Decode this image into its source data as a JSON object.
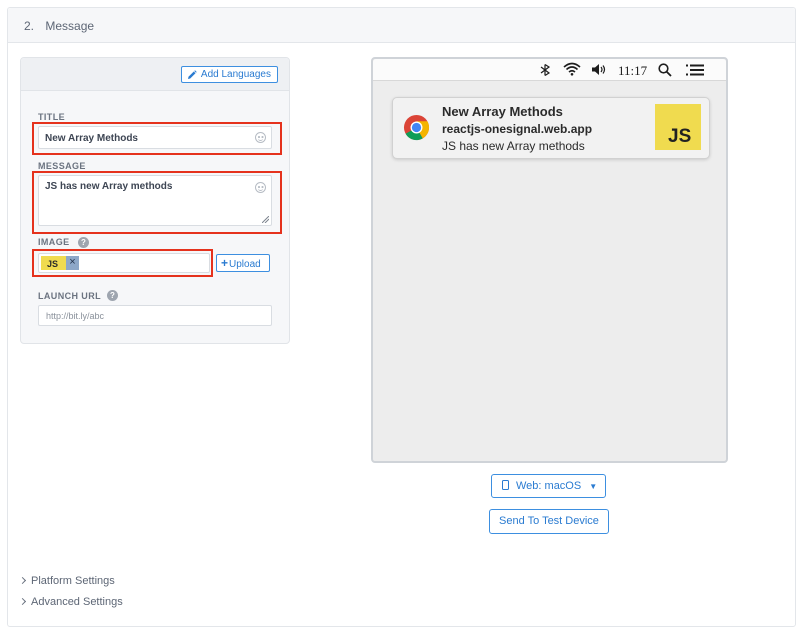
{
  "section": {
    "number": "2.",
    "title": "Message"
  },
  "form": {
    "add_languages_label": "Add Languages",
    "title_label": "TITLE",
    "title_value": "New Array Methods",
    "message_label": "MESSAGE",
    "message_value": "JS has new Array methods",
    "image_label": "IMAGE",
    "image_chip_text": "JS",
    "image_remove_symbol": "×",
    "upload_label": "Upload",
    "launch_url_label": "LAUNCH URL",
    "launch_url_placeholder": "http://bit.ly/abc",
    "help_symbol": "?"
  },
  "preview": {
    "clock": "11:17",
    "notification": {
      "title": "New Array Methods",
      "domain": "reactjs-onesignal.web.app",
      "body": "JS has new Array methods",
      "image_text": "JS"
    }
  },
  "actions": {
    "platform_label": "Web: macOS",
    "send_test_label": "Send To Test Device"
  },
  "collapsibles": {
    "platform_settings": "Platform Settings",
    "advanced_settings": "Advanced Settings"
  },
  "icons": [
    "pencil-icon",
    "smile-icon",
    "help-icon",
    "plus-icon",
    "chrome-icon",
    "wifi-icon",
    "volume-icon",
    "search-icon",
    "list-icon",
    "phone-icon",
    "caret-down-icon",
    "chevron-right-icon"
  ],
  "colors": {
    "accent": "#2a7bd1",
    "highlight_red": "#e5321d",
    "js_yellow": "#f0db4f"
  }
}
